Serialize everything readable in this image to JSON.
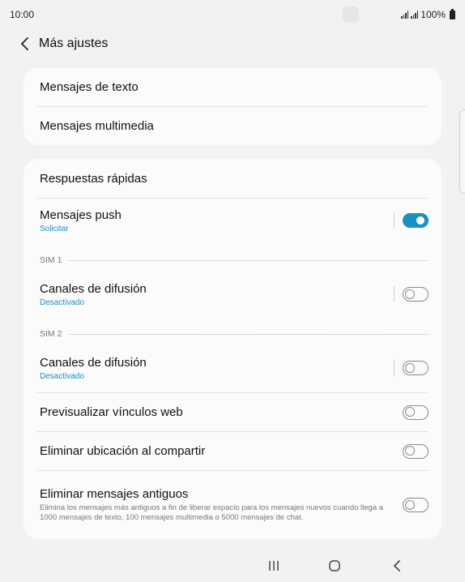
{
  "status_bar": {
    "time": "10:00",
    "battery": "100%",
    "icons": [
      "signal-icon",
      "signal-icon",
      "battery-icon"
    ]
  },
  "header": {
    "back_icon": "chevron-left-icon",
    "title": "Más ajustes"
  },
  "card1": {
    "items": [
      {
        "title": "Mensajes de texto"
      },
      {
        "title": "Mensajes multimedia"
      }
    ]
  },
  "card2": {
    "quick_replies": {
      "title": "Respuestas rápidas"
    },
    "push": {
      "title": "Mensajes push",
      "subtitle": "Solicitar",
      "enabled": true
    },
    "sim1": {
      "label": "SIM 1",
      "broadcast": {
        "title": "Canales de difusión",
        "subtitle": "Desactivado",
        "enabled": false
      }
    },
    "sim2": {
      "label": "SIM 2",
      "broadcast": {
        "title": "Canales de difusión",
        "subtitle": "Desactivado",
        "enabled": false
      }
    },
    "web_preview": {
      "title": "Previsualizar vínculos web",
      "enabled": false
    },
    "remove_location": {
      "title": "Eliminar ubicación al compartir",
      "enabled": false
    },
    "delete_old": {
      "title": "Eliminar mensajes antiguos",
      "description": "Elimina los mensajes más antiguos a fin de liberar espacio para los mensajes nuevos cuando llega a 1000 mensajes de texto, 100 mensajes multimedia o 5000 mensajes de chat.",
      "enabled": false
    }
  },
  "nav_bar": {
    "icons": [
      "recents-icon",
      "home-icon",
      "back-icon"
    ]
  },
  "colors": {
    "accent": "#1a8fc4",
    "background": "#f2f2f2",
    "card": "#fbfbfb"
  }
}
